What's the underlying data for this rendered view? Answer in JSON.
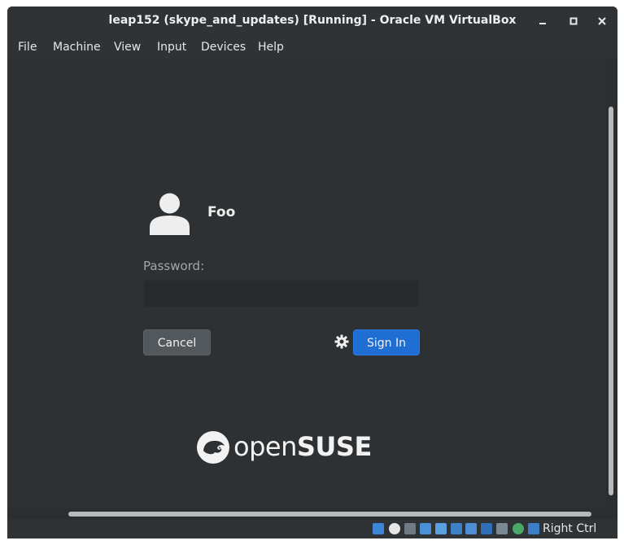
{
  "window": {
    "title": "leap152 (skype_and_updates) [Running] - Oracle VM VirtualBox",
    "controls": {
      "minimize": "–",
      "maximize": "□",
      "close": "×"
    }
  },
  "menubar": {
    "items": [
      "File",
      "Machine",
      "View",
      "Input",
      "Devices",
      "Help"
    ]
  },
  "login": {
    "username": "Foo",
    "password_label": "Password:",
    "password_value": "",
    "cancel_label": "Cancel",
    "signin_label": "Sign In",
    "accent_color": "#1f6ed4"
  },
  "branding": {
    "logo_text_light": "open",
    "logo_text_bold": "SUSE",
    "registered_mark": "®"
  },
  "statusbar": {
    "host_key": "Right Ctrl",
    "icons": [
      "hard-disk-icon",
      "optical-drive-icon",
      "audio-icon",
      "network-icon",
      "usb-icon",
      "shared-folders-icon",
      "display-icon",
      "video-capture-icon",
      "virtualization-icon",
      "mouse-integration-icon",
      "keyboard-icon"
    ]
  }
}
